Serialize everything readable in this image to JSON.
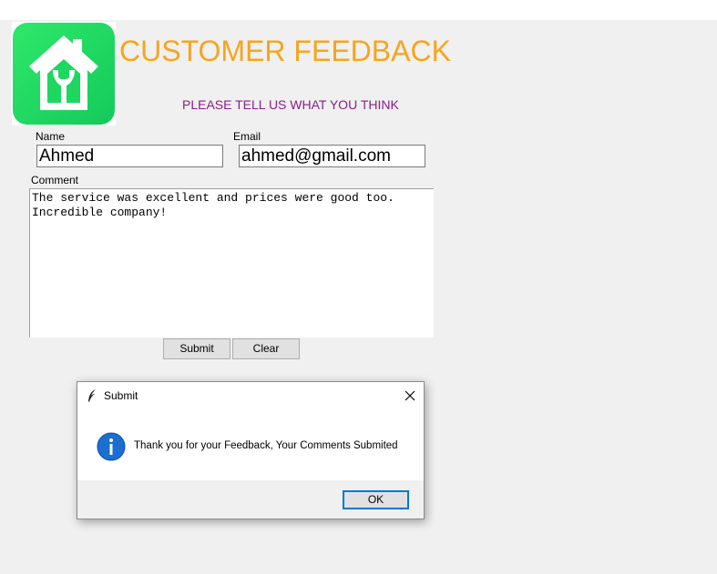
{
  "app": {
    "title": "CUSTOMER FEEDBACK",
    "subtitle": "PLEASE TELL US WHAT YOU THINK",
    "logo_icon": "home-wrench-icon",
    "colors": {
      "title": "#f7a51c",
      "subtitle": "#8a1e8a",
      "logo": "#1ed760"
    }
  },
  "form": {
    "name_label": "Name",
    "name_value": "Ahmed",
    "email_label": "Email",
    "email_value": "ahmed@gmail.com",
    "comment_label": "Comment",
    "comment_value": "The service was excellent and prices were good too.\nIncredible company!",
    "submit_label": "Submit",
    "clear_label": "Clear"
  },
  "dialog": {
    "title": "Submit",
    "title_icon": "feather-icon",
    "message_icon": "info-icon",
    "message": "Thank you for your Feedback, Your Comments Submited",
    "ok_label": "OK",
    "close_icon": "close-icon"
  }
}
